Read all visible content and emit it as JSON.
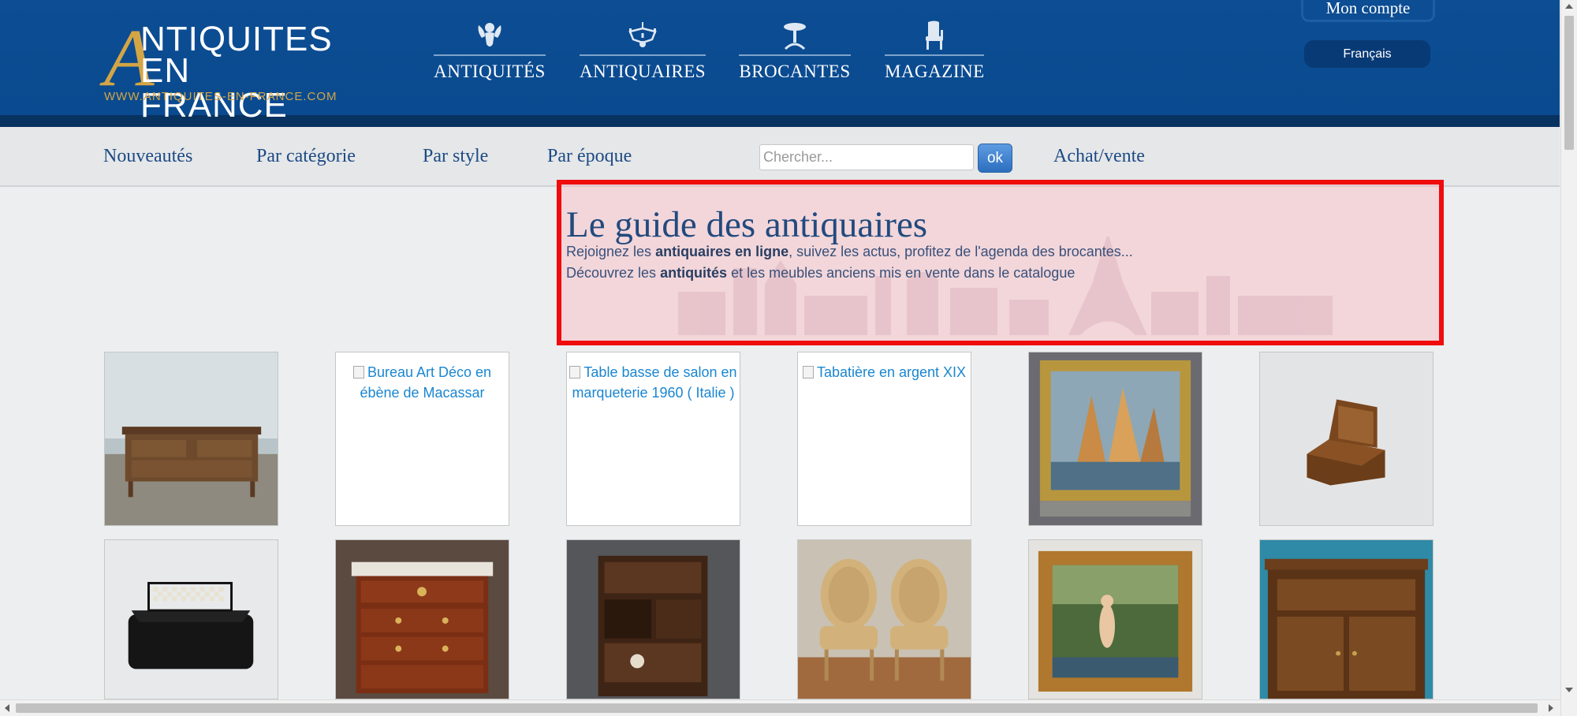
{
  "header": {
    "logo": {
      "line1": "NTIQUITES",
      "line2": "EN FRANCE",
      "letter": "A",
      "url": "WWW.ANTIQUITES-EN-FRANCE.COM"
    },
    "main_nav": [
      {
        "label": "ANTIQUITÉS",
        "icon": "cherub-icon"
      },
      {
        "label": "ANTIQUAIRES",
        "icon": "chandelier-icon"
      },
      {
        "label": "BROCANTES",
        "icon": "pedestal-table-icon"
      },
      {
        "label": "MAGAZINE",
        "icon": "chair-icon"
      }
    ],
    "account_label": "Mon compte",
    "language": "Français"
  },
  "subnav": {
    "links": [
      "Nouveautés",
      "Par catégorie",
      "Par style",
      "Par époque"
    ],
    "search_placeholder": "Chercher...",
    "search_button": "ok",
    "achat_vente": "Achat/vente"
  },
  "hero": {
    "title": "Le guide des antiquaires",
    "line1_a": "Rejoignez les ",
    "line1_b": "antiquaires en ligne",
    "line1_c": ", suivez les actus, profitez de l'agenda des brocantes...",
    "line2_a": "Découvrez les ",
    "line2_b": "antiquités",
    "line2_c": " et les meubles anciens mis en vente dans le catalogue"
  },
  "products": [
    {
      "name": "carved-sideboard",
      "alt": ""
    },
    {
      "name": "broken-image",
      "alt": "Bureau Art Déco en ébène de Macassar"
    },
    {
      "name": "broken-image",
      "alt": "Table basse de salon en marqueterie 1960 ( Italie )"
    },
    {
      "name": "broken-image",
      "alt": "Tabatière en argent XIX"
    },
    {
      "name": "sailboat-painting",
      "alt": ""
    },
    {
      "name": "wooden-box",
      "alt": ""
    },
    {
      "name": "checkered-box",
      "alt": ""
    },
    {
      "name": "marble-top-commode",
      "alt": ""
    },
    {
      "name": "asian-cabinet",
      "alt": ""
    },
    {
      "name": "pair-of-armchairs",
      "alt": ""
    },
    {
      "name": "framed-nude-painting",
      "alt": ""
    },
    {
      "name": "carved-cabinet",
      "alt": ""
    }
  ],
  "colors": {
    "header_blue": "#0c4d93",
    "nav_text": "#1d4a85",
    "highlight_border": "#f00c0c",
    "gold": "#d4a545"
  }
}
